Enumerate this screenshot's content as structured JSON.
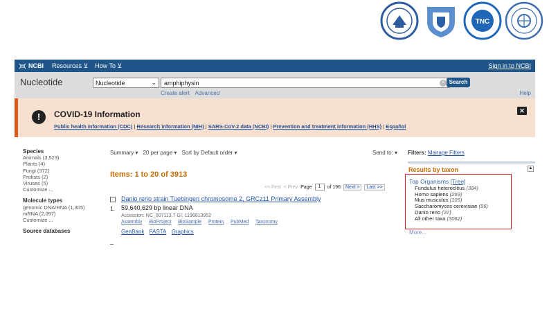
{
  "logos": [
    "university-seal-1",
    "university-logo-2",
    "university-seal-3",
    "university-seal-4"
  ],
  "tnc_label": "TNC",
  "ncbi_bar": {
    "brand": "NCBI",
    "resources": "Resources",
    "howto": "How To",
    "signin": "Sign in to NCBI"
  },
  "search": {
    "db_title": "Nucleotide",
    "db_select": "Nucleotide",
    "query": "amphiphysin",
    "button": "Search",
    "create_alert": "Create alert",
    "advanced": "Advanced",
    "help": "Help"
  },
  "covid": {
    "title": "COVID-19 Information",
    "links": [
      "Public health information (CDC)",
      "Research information (NIH)",
      "SARS-CoV-2 data (NCBI)",
      "Prevention and treatment information (HHS)",
      "Español"
    ],
    "separator": "|"
  },
  "sidebar": {
    "species": {
      "heading": "Species",
      "items": [
        "Animals (3,523)",
        "Plants (4)",
        "Fungi (372)",
        "Protists (2)",
        "Viruses (5)",
        "Customize ..."
      ]
    },
    "molecule": {
      "heading": "Molecule types",
      "items": [
        "genomic DNA/RNA (1,305)",
        "mRNA (2,097)",
        "Customize ..."
      ]
    },
    "source": {
      "heading": "Source databases"
    }
  },
  "toolbar": {
    "summary": "Summary",
    "per_page": "20 per page",
    "sort": "Sort by Default order",
    "send_to": "Send to:"
  },
  "results": {
    "heading": "Items: 1 to 20 of 3913",
    "pager": {
      "first": "<< First",
      "prev": "< Prev",
      "page_label": "Page",
      "page": "1",
      "of": "of 196",
      "next": "Next >",
      "last": "Last >>"
    },
    "item": {
      "number": "1.",
      "title": "Danio rerio strain Tuebingen chromosome 2, GRCz11 Primary Assembly",
      "desc": "59,640,629 bp linear DNA",
      "accession": "Accession: NC_007113.7   GI: 1196813952",
      "links": [
        "Assembly",
        "BioProject",
        "BioSample",
        "Protein",
        "PubMed",
        "Taxonomy"
      ],
      "formats": [
        "GenBank",
        "FASTA",
        "Graphics"
      ]
    }
  },
  "filters": {
    "label": "Filters:",
    "manage": "Manage Filters"
  },
  "taxon": {
    "heading": "Results by taxon",
    "toggle": "▲",
    "top_label": "Top Organisms",
    "tree": "[Tree]",
    "organisms": [
      {
        "name": "Fundulus heteroclitus",
        "count": "(384)"
      },
      {
        "name": "Homo sapiens",
        "count": "(269)"
      },
      {
        "name": "Mus musculus",
        "count": "(105)"
      },
      {
        "name": "Saccharomyces cerevisiae",
        "count": "(56)"
      },
      {
        "name": "Danio rerio",
        "count": "(37)"
      },
      {
        "name": "All other taxa",
        "count": "(3062)"
      }
    ],
    "more": "More..."
  }
}
